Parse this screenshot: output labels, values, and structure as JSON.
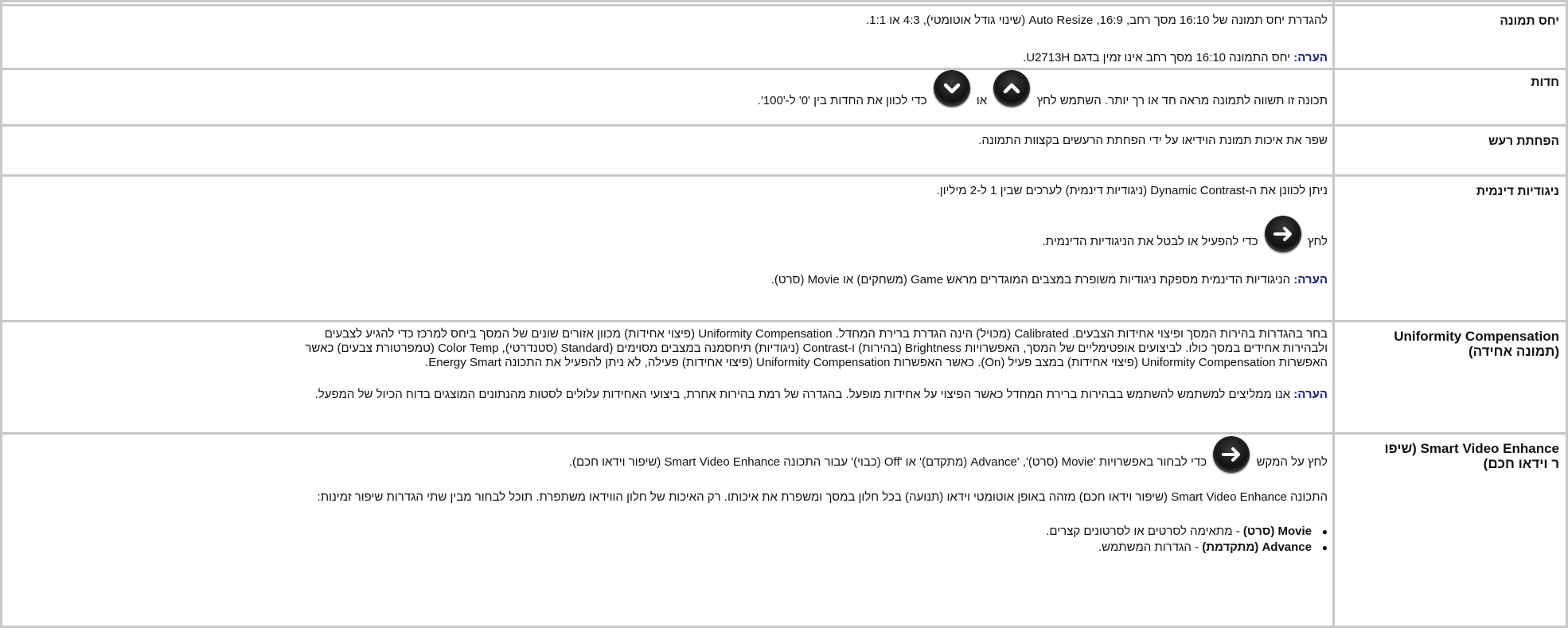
{
  "rows": {
    "aspect": {
      "label": "יחס תמונה",
      "text": "להגדרת יחס תמונה של 16:10 מסך רחב, 16:9, Auto Resize (שינוי גודל אוטומטי), 4:3 או 1:1.",
      "note_label": "הערה:",
      "note_text": "יחס התמונה 16:10 מסך רחב אינו זמין בדגם U2713H."
    },
    "sharpness": {
      "label": "חדות",
      "text_a": "תכונה זו תשווה לתמונה מראה חד או רך יותר. השתמש לחץ",
      "text_or": "או",
      "text_b": "כדי לכוון את החדות בין '0' ל-'100'.",
      "icon_up": "chevron-up-icon",
      "icon_down": "chevron-down-icon"
    },
    "noise": {
      "label": "הפחתת רעש",
      "text": "שפר את איכות תמונת הוידיאו על ידי הפחתת הרעשים בקצוות התמונה."
    },
    "dynamic": {
      "label": "ניגודיות דינמית",
      "text1": "ניתן לכוונן את ה-Dynamic Contrast (ניגודיות דינמית) לערכים שבין 1 ל-2 מיליון.",
      "press": "לחץ",
      "text2": "כדי להפעיל או לבטל את הניגודיות הדינמית.",
      "note_label": "הערה:",
      "note_text": "הניגודיות הדינמית מספקת ניגודיות משופרת במצבים המוגדרים מראש Game (משחקים) או Movie (סרט)."
    },
    "uniformity": {
      "label_line1": "Uniformity Compensation",
      "label_line2": "(תמונה אחידה)",
      "line1": "בחר בהגדרות בהירות המסך ופיצוי אחידות הצבעים. Calibrated (מכויל) הינה הגדרת ברירת המחדל. Uniformity Compensation (פיצוי אחידות) מכוון אזורים שונים של המסך ביחס למרכז כדי להגיע לצבעים",
      "line2": "ולבהירות אחידים במסך כולו. לביצועים אופטימליים של המסך, האפשרויות Brightness (בהירות) ו-Contrast (ניגודיות) תיחסמנה במצבים מסוימים (Standard (סטנדרטי), Color Temp (טמפרטורת צבעים) כאשר",
      "line3": "האפשרות Uniformity Compensation (פיצוי אחידות) במצב פעיל (On). כאשר האפשרות Uniformity Compensation (פיצוי אחידות) פעילה, לא ניתן להפעיל את התכונה Energy Smart.",
      "note_label": "הערה:",
      "note_text": "אנו ממליצים למשתמש להשתמש בבהירות ברירת המחדל כאשר הפיצוי על אחידות מופעל. בהגדרה של רמת בהירות אחרת, ביצועי האחידות עלולים לסטות מהנתונים המוצגים בדוח הכיול של המפעל."
    },
    "smartvideo": {
      "label_line1": "Smart Video Enhance (שיפו",
      "label_line2": "ר וידאו חכם)",
      "press": "לחץ על המקש",
      "text1": "כדי לבחור באפשרויות 'Movie (סרט)', 'Advance (מתקדם)' או 'Off (כבוי)' עבור התכונה Smart Video Enhance (שיפור וידאו חכם).",
      "text2": "התכונה Smart Video Enhance (שיפור וידאו חכם) מזהה באופן אוטומטי וידאו (תנועה) בכל חלון במסך ומשפרת את איכותו. רק האיכות של חלון הווידאו משתפרת. תוכל לבחור מבין שתי הגדרות שיפור זמינות:",
      "opt1_bold": "Movie (סרט)",
      "opt1_rest": " - מתאימה לסרטים או לסרטונים קצרים.",
      "opt2_bold": "Advance (מתקדמת)",
      "opt2_rest": " - הגדרות המשתמש."
    }
  },
  "icons": {
    "enter": "arrow-right-circle-icon"
  }
}
